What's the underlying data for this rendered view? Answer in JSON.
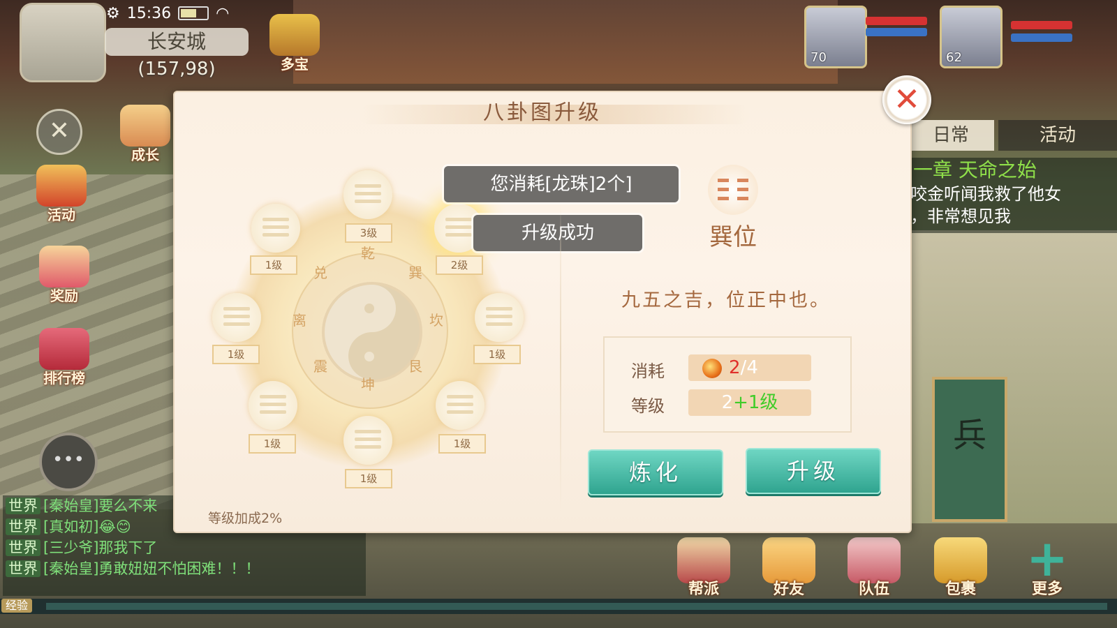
{
  "hud": {
    "time": "15:36",
    "location_name": "长安城",
    "coords": "(157,98)",
    "duobao_label": "多宝",
    "side_buttons": [
      "成长",
      "活动",
      "奖励",
      "排行榜"
    ]
  },
  "party": [
    {
      "level": "70"
    },
    {
      "level": "62"
    }
  ],
  "right_tabs": [
    "日常",
    "活动"
  ],
  "quest": {
    "title": "一章 天命之始",
    "lines": [
      "咬金听闻我救了他女",
      "，非常想见我"
    ]
  },
  "chat": [
    {
      "channel": "世界",
      "text": "[秦始皇]要么不来"
    },
    {
      "channel": "世界",
      "text": "[真如初]😂😊"
    },
    {
      "channel": "世界",
      "text": "[三少爷]那我下了"
    },
    {
      "channel": "世界",
      "text": "[秦始皇]勇敢妞妞不怕困难！！！"
    }
  ],
  "exp_tag": "经验",
  "bottom_buttons": [
    "帮派",
    "好友",
    "队伍",
    "包裹",
    "更多"
  ],
  "scene_banner": "兵",
  "dialog": {
    "title": "八卦图升级",
    "toast_consume": "您消耗[龙珠]2个]",
    "toast_success": "升级成功",
    "wheel_chars": [
      "乾",
      "巽",
      "坎",
      "艮",
      "坤",
      "震",
      "离",
      "兑"
    ],
    "trigram_levels": {
      "top": "3级",
      "top_right": "2级",
      "right": "1级",
      "bottom_right": "1级",
      "bottom": "1级",
      "bottom_left": "1级",
      "left": "1级",
      "top_left": "1级"
    },
    "position_name": "巽位",
    "motto": "九五之吉，位正中也。",
    "stats": {
      "cost_label": "消耗",
      "cost_have": "2",
      "cost_sep": "/",
      "cost_need": "4",
      "level_label": "等级",
      "level_base": "2",
      "level_plus": "+1级"
    },
    "refine_button": "炼化",
    "upgrade_button": "升级",
    "bonus": "等级加成2%"
  },
  "colors": {
    "accent_green": "#2fa48f",
    "cost_red": "#e0302a",
    "level_green": "#3fcc28",
    "title_brown": "#8a5a3c"
  }
}
